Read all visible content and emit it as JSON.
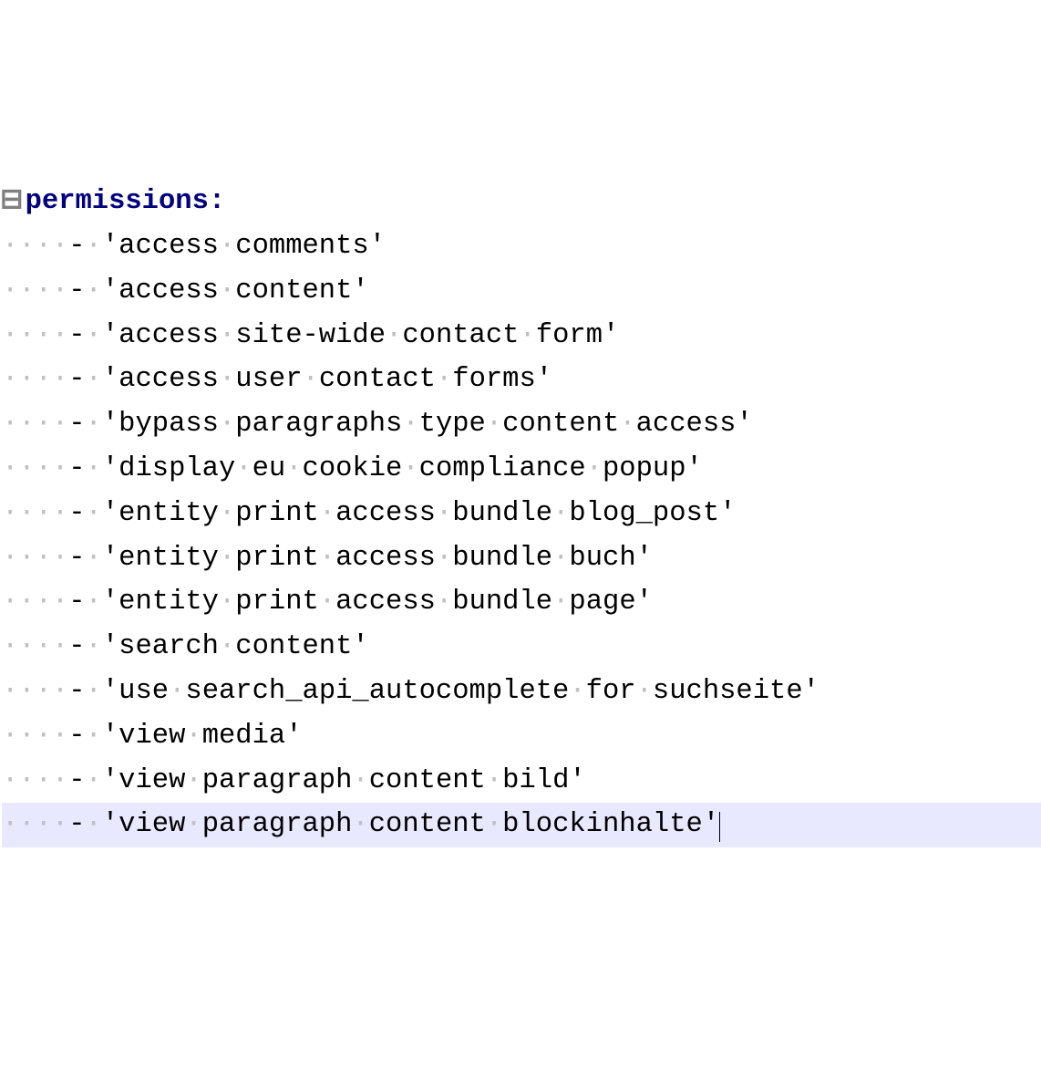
{
  "editor": {
    "expand_marker": "⊟",
    "key": "permissions",
    "colon": ":",
    "indent_ws": "····",
    "dash": "-",
    "sep_ws": "·",
    "quote": "'",
    "items": [
      {
        "display": "access·comments"
      },
      {
        "display": "access·content"
      },
      {
        "display": "access·site-wide·contact·form"
      },
      {
        "display": "access·user·contact·forms"
      },
      {
        "display": "bypass·paragraphs·type·content·access"
      },
      {
        "display": "display·eu·cookie·compliance·popup"
      },
      {
        "display": "entity·print·access·bundle·blog_post"
      },
      {
        "display": "entity·print·access·bundle·buch"
      },
      {
        "display": "entity·print·access·bundle·page"
      },
      {
        "display": "search·content"
      },
      {
        "display": "use·search_api_autocomplete·for·suchseite"
      },
      {
        "display": "view·media"
      },
      {
        "display": "view·paragraph·content·bild"
      },
      {
        "display": "view·paragraph·content·blockinhalte"
      }
    ],
    "highlighted_index": 13,
    "cursor_after_index": 13
  }
}
